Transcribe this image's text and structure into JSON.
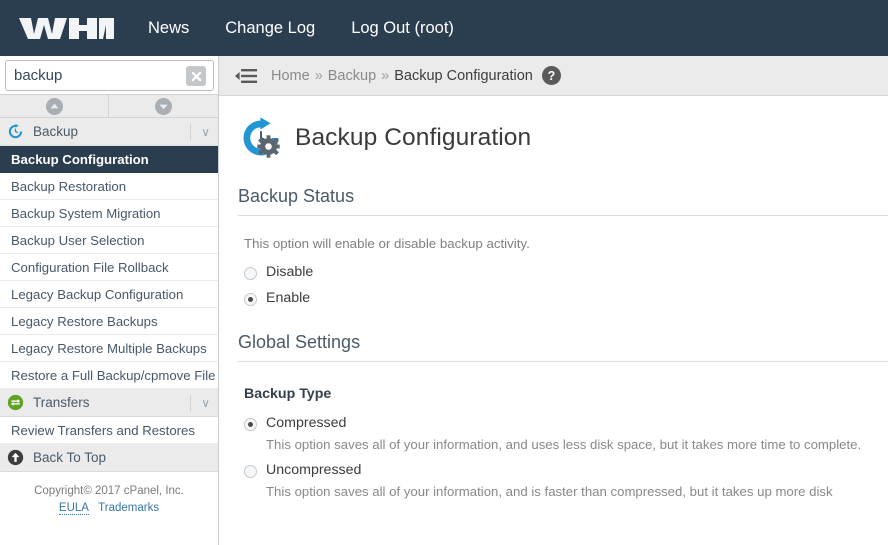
{
  "topnav": {
    "logo_text": "WHM",
    "links": [
      {
        "label": "News"
      },
      {
        "label": "Change Log"
      },
      {
        "label": "Log Out (root)"
      }
    ]
  },
  "breadcrumb": {
    "collapse_icon": "collapse-menu-icon",
    "items": [
      {
        "label": "Home",
        "current": false
      },
      {
        "label": "Backup",
        "current": false
      },
      {
        "label": "Backup Configuration",
        "current": true
      }
    ],
    "separator": "»",
    "help_icon": "help-circle-icon",
    "help_glyph": "?"
  },
  "sidebar": {
    "search": {
      "value": "backup",
      "placeholder": "Search",
      "clear_icon": "clear-x-icon"
    },
    "pager": {
      "up_icon": "chevron-up-circle-icon",
      "down_icon": "chevron-down-circle-icon"
    },
    "groups": [
      {
        "label": "Backup",
        "icon": "backup-restore-clock-icon",
        "icon_color": "#2196d3",
        "chevron": "∨",
        "items": [
          {
            "label": "Backup Configuration",
            "active": true
          },
          {
            "label": "Backup Restoration",
            "active": false
          },
          {
            "label": "Backup System Migration",
            "active": false
          },
          {
            "label": "Backup User Selection",
            "active": false
          },
          {
            "label": "Configuration File Rollback",
            "active": false
          },
          {
            "label": "Legacy Backup Configuration",
            "active": false
          },
          {
            "label": "Legacy Restore Backups",
            "active": false
          },
          {
            "label": "Legacy Restore Multiple Backups",
            "active": false
          },
          {
            "label": "Restore a Full Backup/cpmove File",
            "active": false
          }
        ]
      },
      {
        "label": "Transfers",
        "icon": "transfers-arrows-icon",
        "icon_color": "#5fa225",
        "chevron": "∨",
        "items": [
          {
            "label": "Review Transfers and Restores",
            "active": false
          }
        ]
      }
    ],
    "back_to_top": {
      "label": "Back To Top",
      "icon": "arrow-up-circle-icon"
    },
    "footer": {
      "copyright": "Copyright© 2017 cPanel, Inc.",
      "eula_label": "EULA",
      "trademarks_label": "Trademarks"
    }
  },
  "main": {
    "page_icon": "backup-configuration-gear-icon",
    "page_title": "Backup Configuration",
    "sections": [
      {
        "heading": "Backup Status",
        "description": "This option will enable or disable backup activity.",
        "options": [
          {
            "label": "Disable",
            "checked": false,
            "description": ""
          },
          {
            "label": "Enable",
            "checked": true,
            "description": ""
          }
        ]
      },
      {
        "heading": "Global Settings",
        "subheading": "Backup Type",
        "options": [
          {
            "label": "Compressed",
            "checked": true,
            "description": "This option saves all of your information, and uses less disk space, but it takes more time to complete."
          },
          {
            "label": "Uncompressed",
            "checked": false,
            "description": "This option saves all of your information, and is faster than compressed, but it takes up more disk"
          }
        ]
      }
    ]
  },
  "colors": {
    "brand_navy": "#2b3e50",
    "accent_cyan": "#2196d3",
    "accent_green": "#5fa225",
    "link_blue": "#3875a8",
    "bar_gray": "#ebebeb"
  }
}
